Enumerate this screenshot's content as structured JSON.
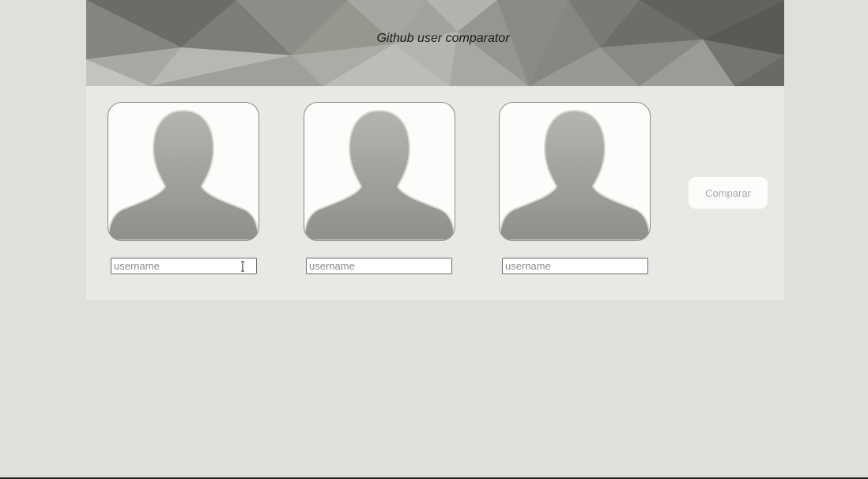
{
  "header": {
    "title": "Github user comparator"
  },
  "users": [
    {
      "avatar_icon": "default-user-silhouette-icon",
      "input_placeholder": "username",
      "input_value": ""
    },
    {
      "avatar_icon": "default-user-silhouette-icon",
      "input_placeholder": "username",
      "input_value": ""
    },
    {
      "avatar_icon": "default-user-silhouette-icon",
      "input_placeholder": "username",
      "input_value": ""
    }
  ],
  "compare_button": {
    "label": "Comparar"
  },
  "colors": {
    "page_background": "#dfdfdb",
    "panel_background": "#e8e8e4",
    "card_background": "#fcfcfa",
    "silhouette": "#a5a5a2",
    "button_text": "#a8a8a8"
  }
}
